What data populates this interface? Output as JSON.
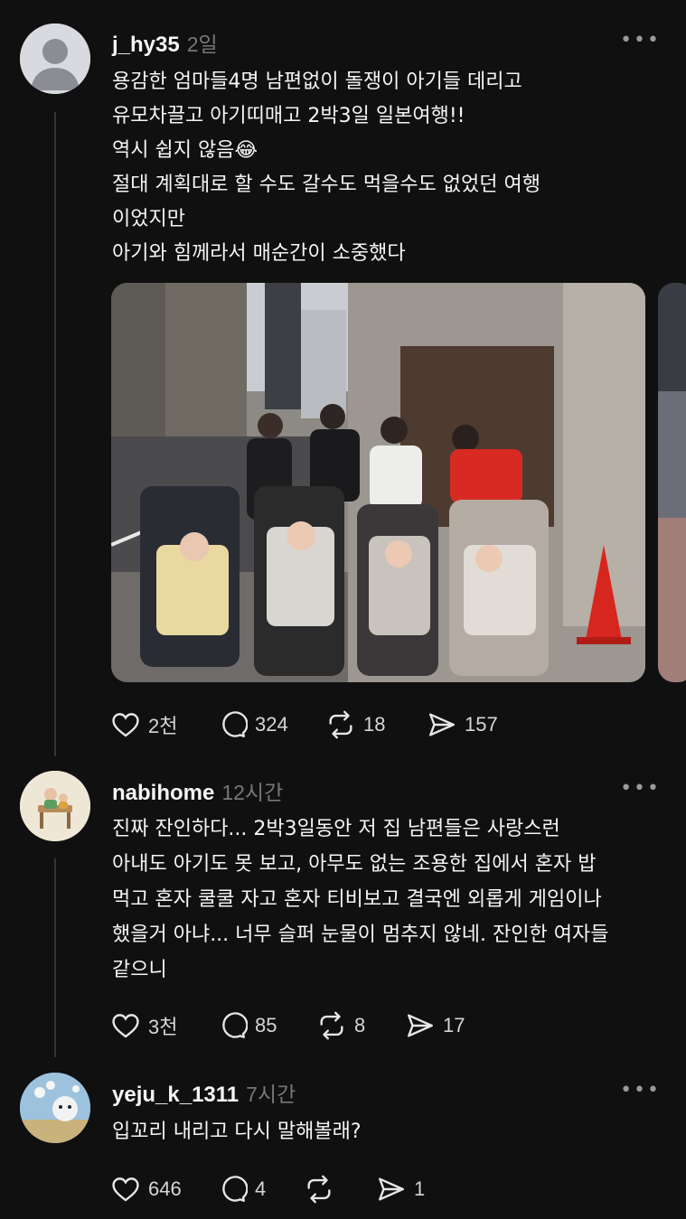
{
  "posts": [
    {
      "username": "j_hy35",
      "time": "2일",
      "text": [
        "용감한 엄마들4명  남편없이 돌쟁이 아기들 데리고",
        "유모차끌고 아기띠매고 2박3일 일본여행!!",
        "역시 쉽지 않음😂",
        "절대 계획대로 할 수도 갈수도 먹을수도  없었던 여행",
        "이었지만",
        "아기와 힘께라서 매순간이 소중했다"
      ],
      "likes": "2천",
      "replies": "324",
      "reposts": "18",
      "shares": "157"
    },
    {
      "username": "nabihome",
      "time": "12시간",
      "text": [
        "진짜 잔인하다... 2박3일동안 저 집 남편들은 사랑스런",
        "아내도 아기도 못 보고, 아무도 없는 조용한 집에서 혼자 밥",
        "먹고 혼자 쿨쿨 자고 혼자 티비보고 결국엔 외롭게 게임이나",
        "했을거 아냐... 너무 슬퍼 눈물이 멈추지 않네. 잔인한 여자들",
        "같으니"
      ],
      "likes": "3천",
      "replies": "85",
      "reposts": "8",
      "shares": "17"
    },
    {
      "username": "yeju_k_1311",
      "time": "7시간",
      "text": [
        "입꼬리 내리고 다시 말해볼래?"
      ],
      "likes": "646",
      "replies": "4",
      "reposts": "",
      "shares": "1"
    }
  ],
  "icons": {
    "like": "heart-icon",
    "reply": "comment-icon",
    "repost": "repost-icon",
    "share": "send-icon",
    "more": "more-dots-icon"
  },
  "more_glyph": "•••",
  "colors": {
    "background": "#101010",
    "text": "#f3f5f7",
    "muted": "#777777",
    "thread_line": "#333638"
  }
}
